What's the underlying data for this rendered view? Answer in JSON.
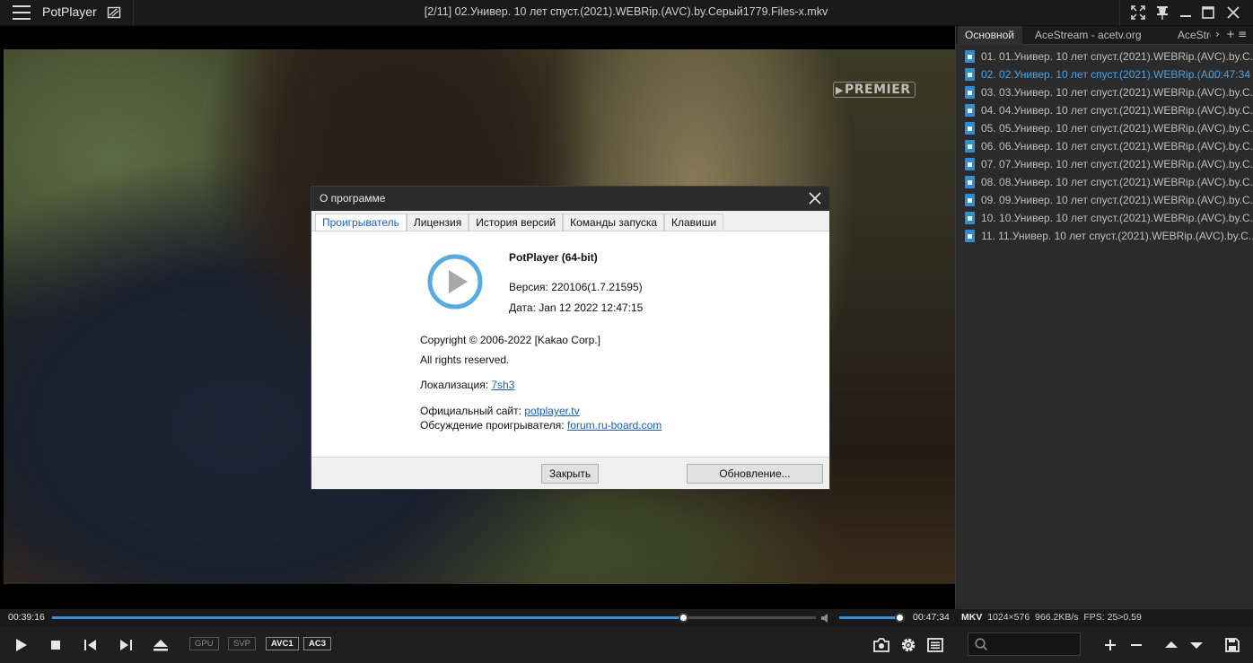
{
  "titlebar": {
    "app_name": "PotPlayer",
    "file_title": "[2/11] 02.Универ. 10 лет спуст.(2021).WEBRip.(AVC).by.Серый1779.Files-x.mkv"
  },
  "video": {
    "channel_logo": "PREMIER"
  },
  "about_dialog": {
    "title": "О программе",
    "tabs": [
      "Проигрыватель",
      "Лицензия",
      "История версий",
      "Команды запуска",
      "Клавиши"
    ],
    "active_tab": "Проигрыватель",
    "product": "PotPlayer (64-bit)",
    "version": "Версия: 220106(1.7.21595)",
    "date": "Дата: Jan 12 2022 12:47:15",
    "copyright": "Copyright © 2006-2022 [Kakao Corp.]",
    "rights": "All rights reserved.",
    "localization_label": "Локализация:",
    "localization_link": "7sh3",
    "site_label": "Официальный сайт:",
    "site_link": "potplayer.tv",
    "forum_label": "Обсуждение проигрывателя:",
    "forum_link": "forum.ru-board.com",
    "close_button": "Закрыть",
    "update_button": "Обновление...",
    "accent_color": "#1a5fb4"
  },
  "playlist": {
    "tabs": [
      "Основной",
      "AceStream - acetv.org",
      "AceStre"
    ],
    "tab_controls": [
      "›",
      "+",
      "≡"
    ],
    "items": [
      "01. 01.Универ. 10 лет спуст.(2021).WEBRip.(AVC).by.С...",
      "02. 02.Универ. 10 лет спуст.(2021).WEBRip.(А...",
      "03. 03.Универ. 10 лет спуст.(2021).WEBRip.(AVC).by.С...",
      "04. 04.Универ. 10 лет спуст.(2021).WEBRip.(AVC).by.С...",
      "05. 05.Универ. 10 лет спуст.(2021).WEBRip.(AVC).by.С...",
      "06. 06.Универ. 10 лет спуст.(2021).WEBRip.(AVC).by.С...",
      "07. 07.Универ. 10 лет спуст.(2021).WEBRip.(AVC).by.С...",
      "08. 08.Универ. 10 лет спуст.(2021).WEBRip.(AVC).by.С...",
      "09. 09.Универ. 10 лет спуст.(2021).WEBRip.(AVC).by.С...",
      "10. 10.Универ. 10 лет спуст.(2021).WEBRip.(AVC).by.С...",
      "11. 11.Универ. 10 лет спуст.(2021).WEBRip.(AVC).by.С..."
    ],
    "current_index": 1,
    "current_duration": "00:47:34",
    "current_color": "#4aa3e8"
  },
  "seekbar": {
    "elapsed": "00:39:16",
    "total": "00:47:34",
    "progress": 0.8255,
    "volume": 0.96,
    "accent_color": "#3b8fe0"
  },
  "info": {
    "container": "MKV",
    "resolution": "1024×576",
    "bitrate": "966.2KB/s",
    "fps": "FPS: 25>0.59"
  },
  "controls": {
    "badges": [
      "GPU",
      "SVP",
      "AVC1",
      "AC3"
    ],
    "icons": [
      "play-icon",
      "stop-icon",
      "previous-icon",
      "next-icon",
      "eject-icon",
      "camera-icon",
      "gear-icon",
      "playlist-icon",
      "search-icon",
      "add-icon",
      "remove-icon",
      "move-up-icon",
      "move-down-icon",
      "save-icon"
    ],
    "search_placeholder": ""
  }
}
